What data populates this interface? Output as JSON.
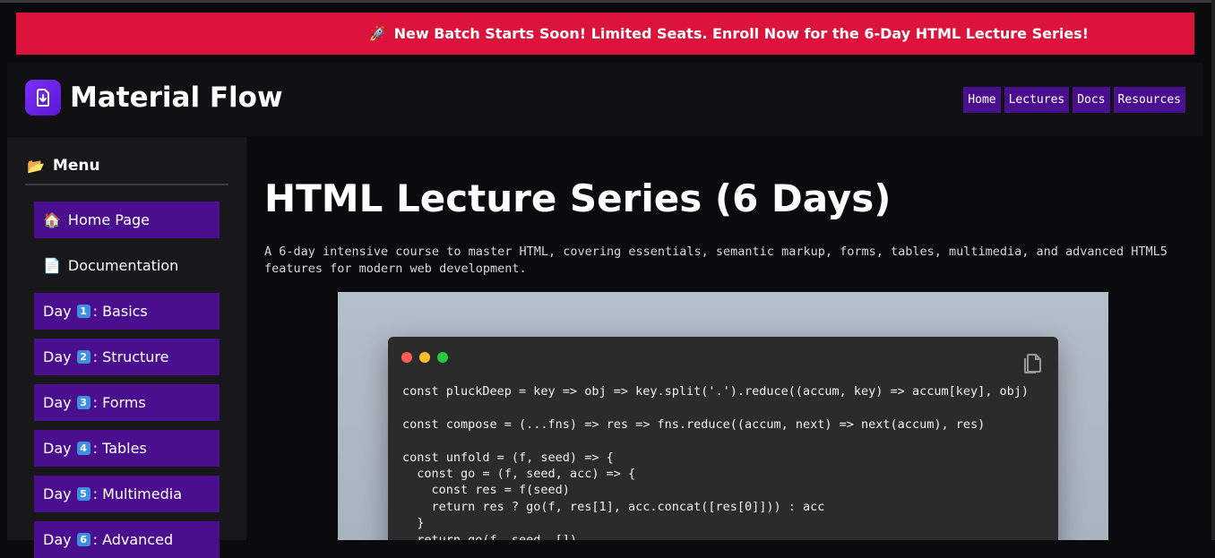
{
  "announcement": {
    "icon": "rocket-icon",
    "text": "New Batch Starts Soon! Limited Seats. Enroll Now for the 6-Day HTML Lecture Series!"
  },
  "header": {
    "brand_title": "Material Flow",
    "logo_icon": "clipboard-download-icon",
    "nav": [
      {
        "label": "Home"
      },
      {
        "label": "Lectures"
      },
      {
        "label": "Docs"
      },
      {
        "label": "Resources"
      }
    ]
  },
  "sidebar": {
    "heading": "Menu",
    "heading_icon": "folder-icon",
    "items": [
      {
        "icon": "house-icon",
        "label": "Home Page"
      },
      {
        "icon": "page-icon",
        "label": "Documentation"
      },
      {
        "prefix": "Day",
        "num": "1",
        "label": ": Basics"
      },
      {
        "prefix": "Day",
        "num": "2",
        "label": ": Structure"
      },
      {
        "prefix": "Day",
        "num": "3",
        "label": ": Forms"
      },
      {
        "prefix": "Day",
        "num": "4",
        "label": ": Tables"
      },
      {
        "prefix": "Day",
        "num": "5",
        "label": ": Multimedia"
      },
      {
        "prefix": "Day",
        "num": "6",
        "label": ": Advanced"
      }
    ]
  },
  "main": {
    "title": "HTML Lecture Series (6 Days)",
    "description": "A 6-day intensive course to master HTML, covering essentials, semantic markup, forms, tables, multimedia, and advanced HTML5 features for modern web development.",
    "code": {
      "copy_icon": "copy-icon",
      "lines": "const pluckDeep = key => obj => key.split('.').reduce((accum, key) => accum[key], obj)\n\nconst compose = (...fns) => res => fns.reduce((accum, next) => next(accum), res)\n\nconst unfold = (f, seed) => {\n  const go = (f, seed, acc) => {\n    const res = f(seed)\n    return res ? go(f, res[1], acc.concat([res[0]])) : acc\n  }\n  return go(f, seed, [])\n}"
    }
  },
  "colors": {
    "announcement_bg": "#dc143c",
    "accent_purple": "#4a0f8f",
    "page_bg": "#0b0a0d"
  }
}
